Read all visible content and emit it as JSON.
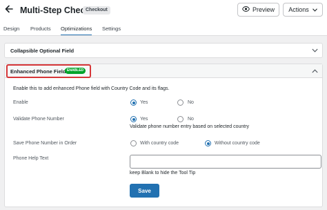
{
  "header": {
    "title": "Multi-Step Checkout",
    "type_badge": "Checkout",
    "preview_label": "Preview",
    "actions_label": "Actions"
  },
  "tabs": [
    {
      "label": "Design"
    },
    {
      "label": "Products"
    },
    {
      "label": "Optimizations",
      "active": true
    },
    {
      "label": "Settings"
    }
  ],
  "panels": {
    "collapsible": {
      "title": "Collapsible Optional Field"
    },
    "enhanced": {
      "title": "Enhanced Phone Field",
      "badge": "ENABLED",
      "intro": "Enable this to add enhanced Phone field with Country Code and its flags.",
      "enable": {
        "label": "Enable",
        "options": [
          "Yes",
          "No"
        ],
        "selected": "Yes"
      },
      "validate": {
        "label": "Validate Phone Number",
        "options": [
          "Yes",
          "No"
        ],
        "selected": "Yes",
        "help": "Validate phone number entry based on selected country"
      },
      "save_format": {
        "label": "Save Phone Number in Order",
        "options": [
          "With country code",
          "Without country code"
        ],
        "selected": "Without country code"
      },
      "help_text": {
        "label": "Phone Help Text",
        "value": "",
        "help": "keep Blank to hide the Tool Tip"
      },
      "save_label": "Save"
    }
  },
  "colors": {
    "accent": "#2271b1",
    "highlight": "#d63638",
    "badge": "#00a32a"
  }
}
